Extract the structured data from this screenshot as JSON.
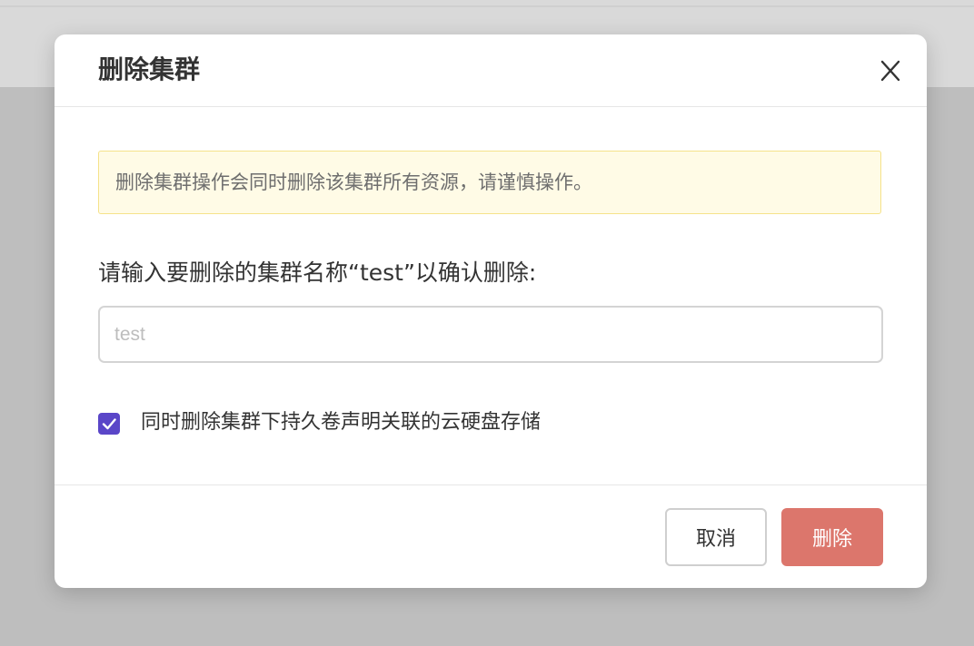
{
  "dialog": {
    "title": "删除集群",
    "close_icon": "close-icon"
  },
  "alert": {
    "message": "删除集群操作会同时删除该集群所有资源，请谨慎操作。",
    "background": "#fffbe6",
    "border": "#f5e28a"
  },
  "confirm": {
    "label": "请输入要删除的集群名称“test”以确认删除:",
    "input_value": "",
    "input_placeholder": "test"
  },
  "option": {
    "checked": true,
    "label": "同时删除集群下持久卷声明关联的云硬盘存储",
    "accent": "#5a46c8"
  },
  "footer": {
    "cancel_label": "取消",
    "delete_label": "删除",
    "delete_color": "#dc766c"
  }
}
